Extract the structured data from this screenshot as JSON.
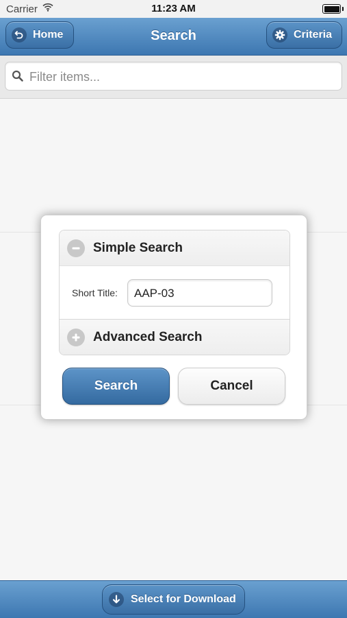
{
  "status_bar": {
    "carrier": "Carrier",
    "time": "11:23 AM"
  },
  "header": {
    "title": "Search",
    "home_label": "Home",
    "criteria_label": "Criteria"
  },
  "filter": {
    "placeholder": "Filter items...",
    "value": ""
  },
  "dialog": {
    "simple_search_label": "Simple Search",
    "short_title_label": "Short Title:",
    "short_title_value": "AAP-03",
    "advanced_search_label": "Advanced Search",
    "search_button": "Search",
    "cancel_button": "Cancel"
  },
  "footer": {
    "download_label": "Select for Download"
  },
  "icons": {
    "home": "back-arrow-icon",
    "criteria": "gear-icon",
    "filter": "search-icon",
    "simple": "minus-circle-icon",
    "advanced": "plus-circle-icon",
    "download": "arrow-down-icon"
  },
  "colors": {
    "bar_gradient_top": "#6aa0d0",
    "bar_gradient_bottom": "#3d77b1",
    "button_border": "#24507e"
  }
}
